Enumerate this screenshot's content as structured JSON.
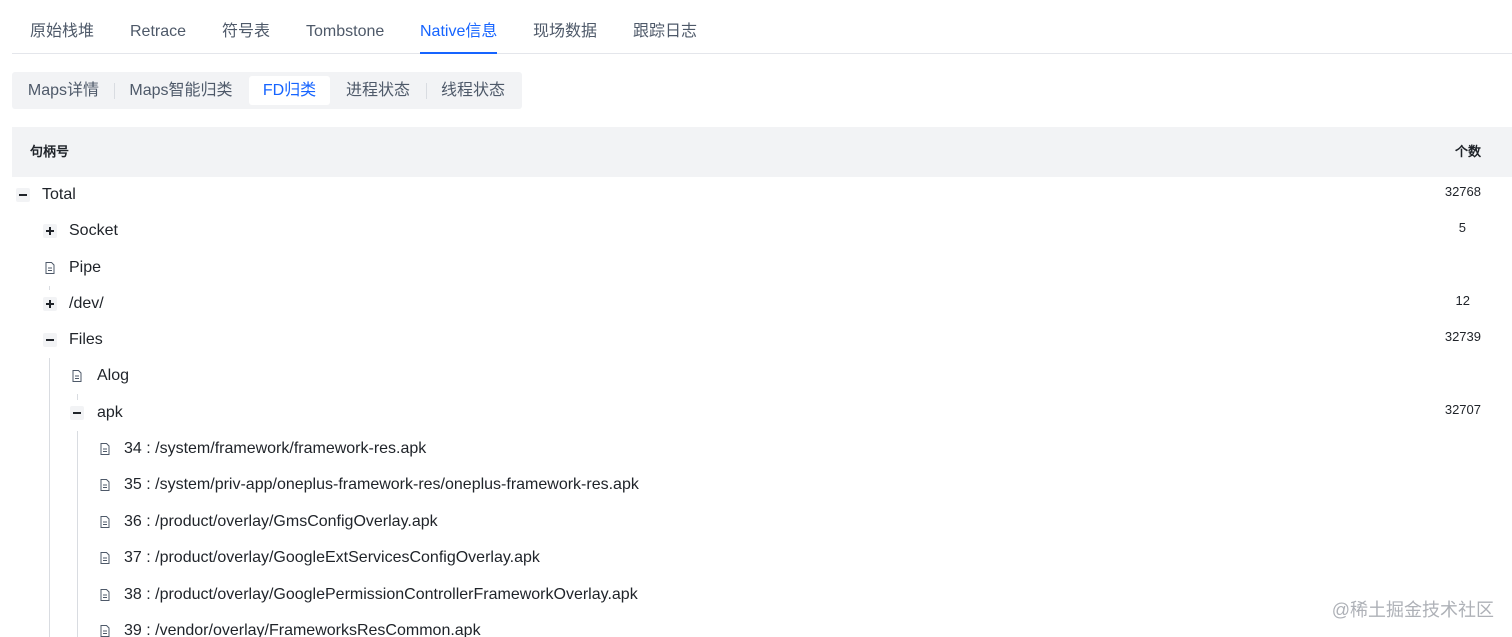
{
  "top_tabs": {
    "raw_stack": "原始栈堆",
    "retrace": "Retrace",
    "symbols": "符号表",
    "tombstone": "Tombstone",
    "native": "Native信息",
    "scene_data": "现场数据",
    "trace_log": "跟踪日志"
  },
  "sub_tabs": {
    "maps_detail": "Maps详情",
    "maps_smart": "Maps智能归类",
    "fd_class": "FD归类",
    "process_state": "进程状态",
    "thread_state": "线程状态"
  },
  "table": {
    "col_handle": "句柄号",
    "col_count": "个数"
  },
  "tree": {
    "total": {
      "label": "Total",
      "count": "32768",
      "expanded": true
    },
    "socket": {
      "label": "Socket",
      "count": "5",
      "expanded": false
    },
    "pipe": {
      "label": "Pipe"
    },
    "dev": {
      "label": "/dev/",
      "count": "12",
      "expanded": false
    },
    "files": {
      "label": "Files",
      "count": "32739",
      "expanded": true
    },
    "alog": {
      "label": "Alog"
    },
    "apk": {
      "label": "apk",
      "count": "32707",
      "expanded": true
    },
    "apk_items": [
      "34 : /system/framework/framework-res.apk",
      "35 : /system/priv-app/oneplus-framework-res/oneplus-framework-res.apk",
      "36 : /product/overlay/GmsConfigOverlay.apk",
      "37 : /product/overlay/GoogleExtServicesConfigOverlay.apk",
      "38 : /product/overlay/GooglePermissionControllerFrameworkOverlay.apk",
      "39 : /vendor/overlay/FrameworksResCommon.apk"
    ]
  },
  "watermark": "@稀土掘金技术社区",
  "colors": {
    "accent": "#1664ff",
    "header_bg": "#f2f3f5",
    "text": "#1f2329",
    "muted": "#4e5969"
  }
}
